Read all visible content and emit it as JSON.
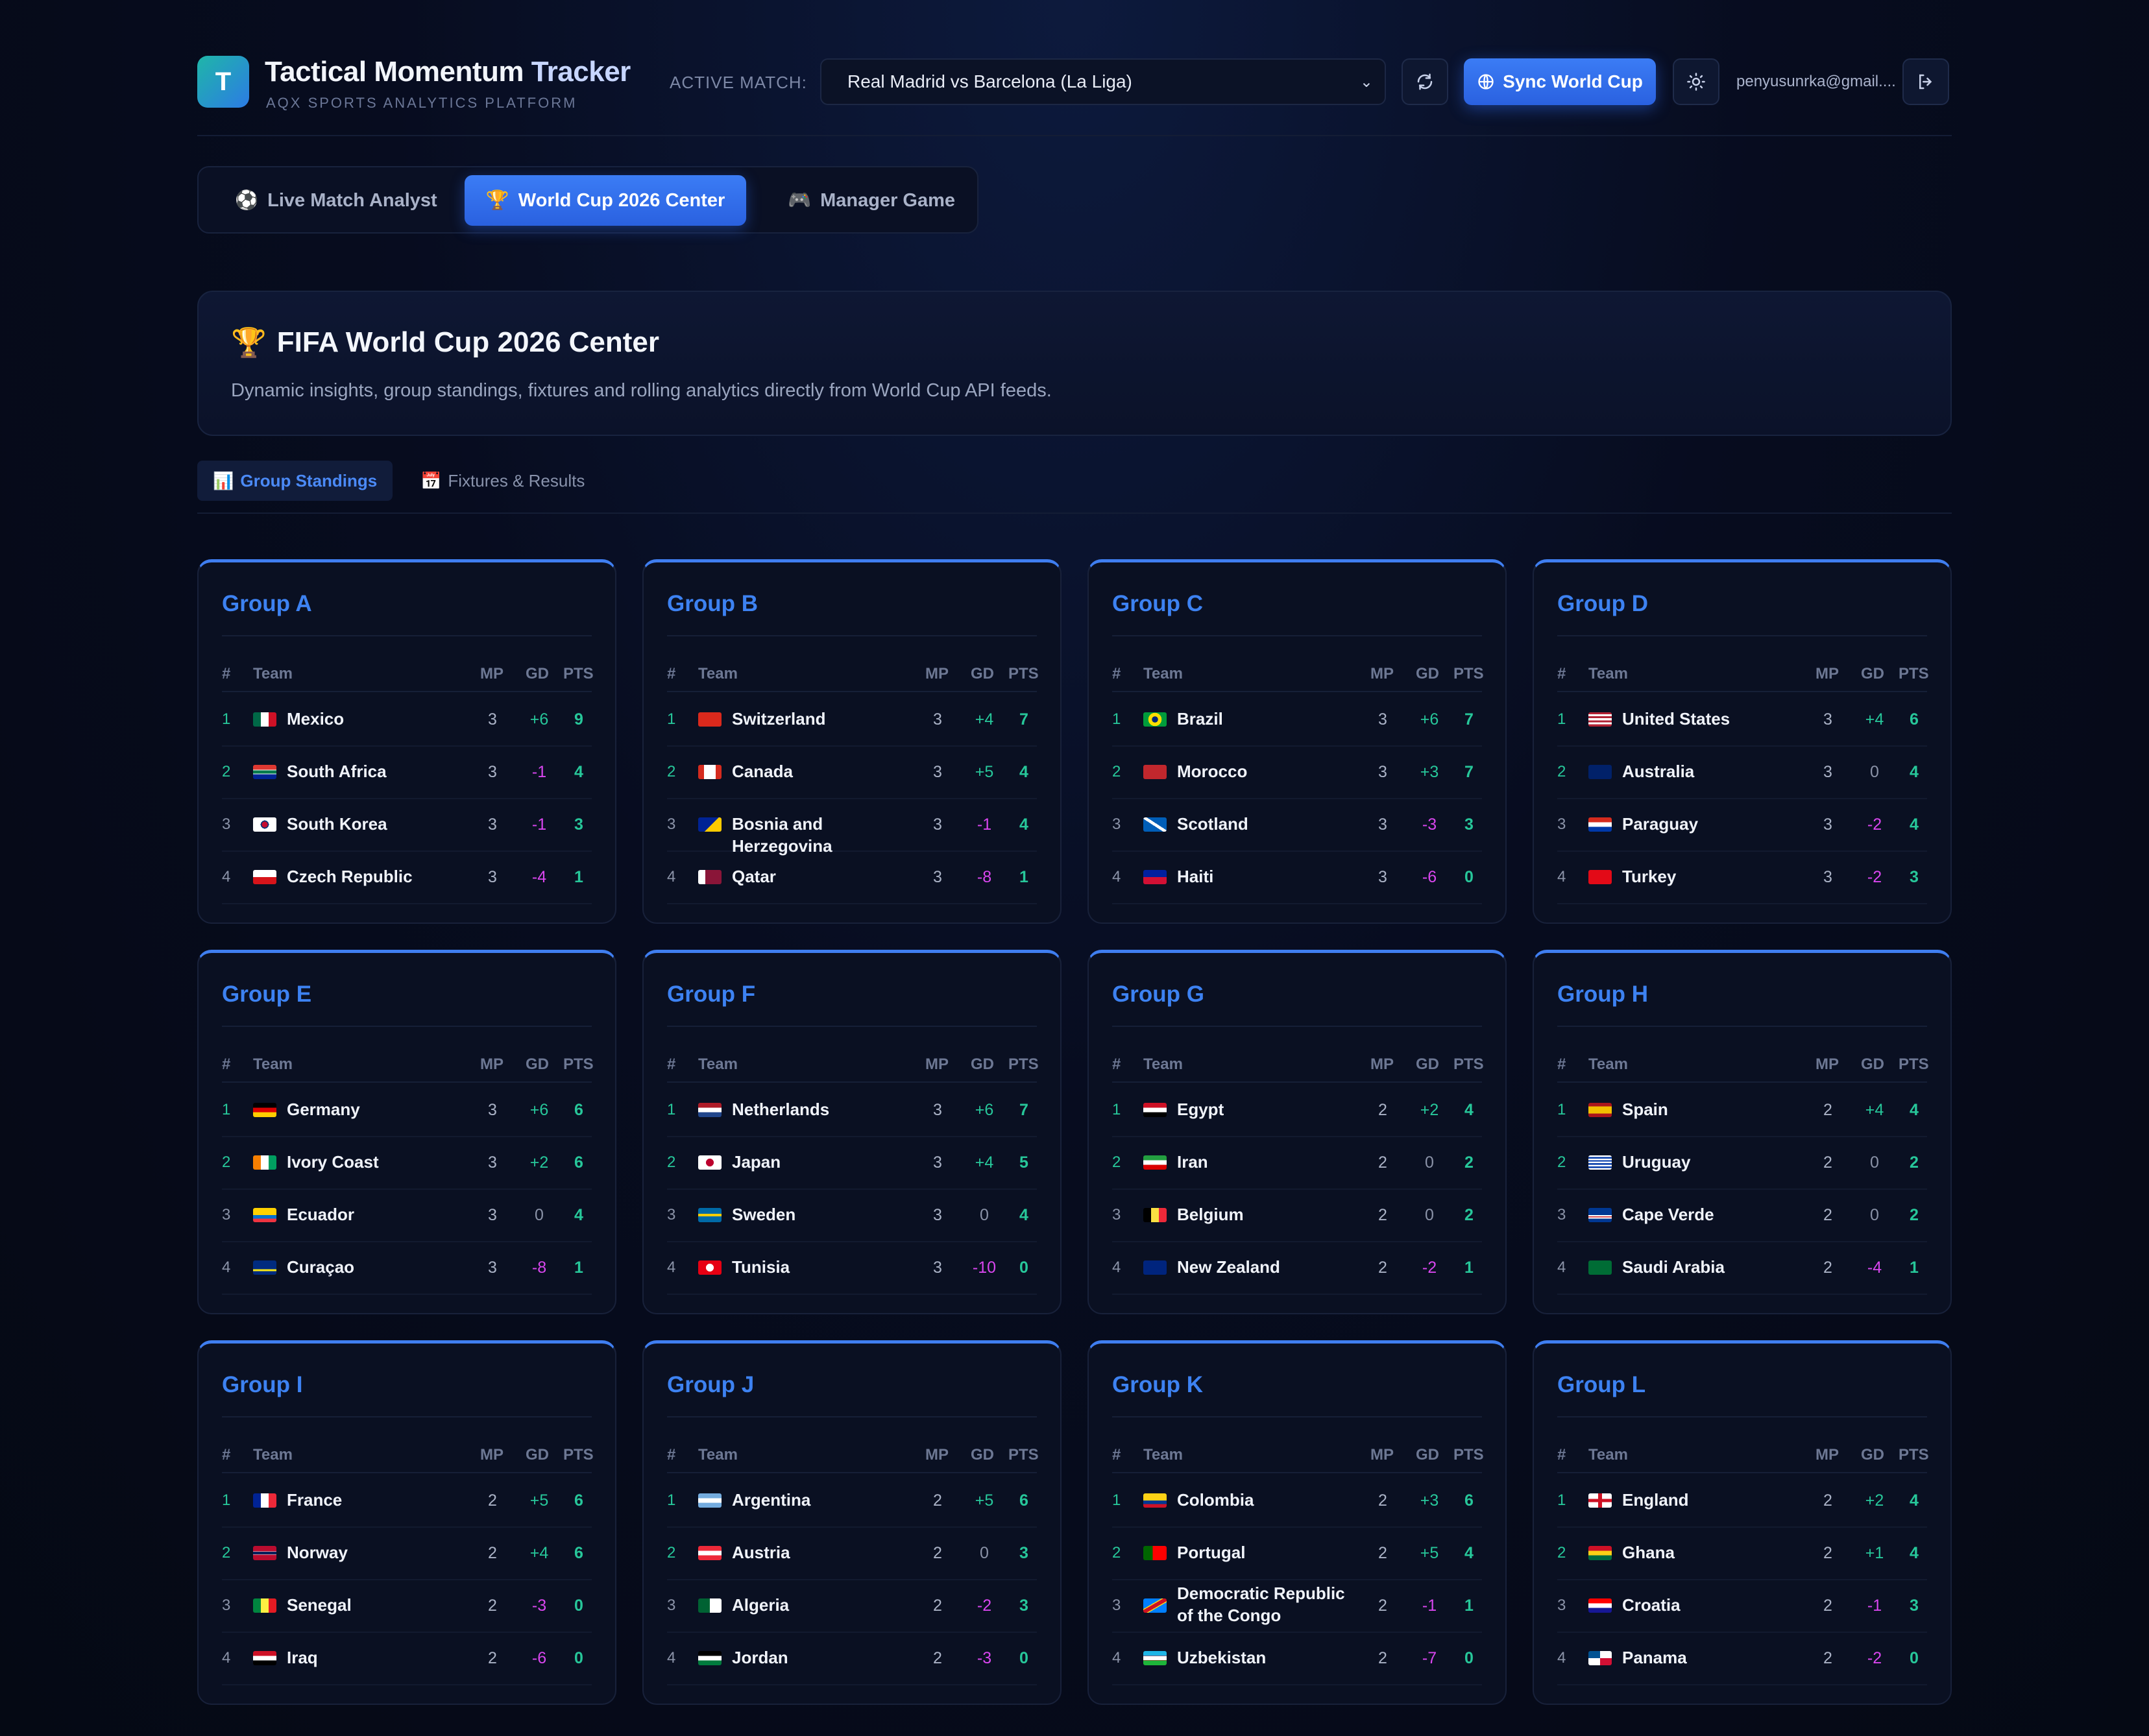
{
  "header": {
    "logo_letter": "T",
    "title_main": "Tactical Momentum ",
    "title_accent": "Tracker",
    "subtitle": "AQX SPORTS ANALYTICS PLATFORM",
    "active_match_label": "ACTIVE MATCH:",
    "active_match_value": "Real Madrid vs Barcelona (La Liga)",
    "sync_label": "Sync World Cup",
    "user_email": "penyusunrka@gmail....",
    "icons": [
      "refresh-icon",
      "globe-icon",
      "sun-icon",
      "logout-icon"
    ]
  },
  "main_tabs": [
    {
      "label": "Live Match Analyst",
      "icon": "⚽",
      "active": false
    },
    {
      "label": "World Cup 2026 Center",
      "icon": "🏆",
      "active": true
    },
    {
      "label": "Manager Game",
      "icon": "🎮",
      "active": false
    }
  ],
  "hero": {
    "icon": "🏆",
    "title": "FIFA World Cup 2026 Center",
    "description": "Dynamic insights, group standings, fixtures and rolling analytics directly from World Cup API feeds."
  },
  "sub_tabs": [
    {
      "label": "Group Standings",
      "icon": "📊",
      "active": true
    },
    {
      "label": "Fixtures & Results",
      "icon": "📅",
      "active": false
    }
  ],
  "table_headers": {
    "rank": "#",
    "team": "Team",
    "mp": "MP",
    "gd": "GD",
    "pts": "PTS"
  },
  "colors": {
    "accent": "#3d82f2",
    "positive": "#27c79a",
    "negative": "#d946ef",
    "neutral": "#8b93a8"
  },
  "groups": [
    {
      "name": "Group A",
      "teams": [
        {
          "rank": "1",
          "team": "Mexico",
          "flag": "mexico",
          "mp": "3",
          "gd": "+6",
          "pts": "9"
        },
        {
          "rank": "2",
          "team": "South Africa",
          "flag": "south-africa",
          "mp": "3",
          "gd": "-1",
          "pts": "4"
        },
        {
          "rank": "3",
          "team": "South Korea",
          "flag": "south-korea",
          "mp": "3",
          "gd": "-1",
          "pts": "3"
        },
        {
          "rank": "4",
          "team": "Czech Republic",
          "flag": "czech-republic",
          "mp": "3",
          "gd": "-4",
          "pts": "1"
        }
      ]
    },
    {
      "name": "Group B",
      "teams": [
        {
          "rank": "1",
          "team": "Switzerland",
          "flag": "switzerland",
          "mp": "3",
          "gd": "+4",
          "pts": "7"
        },
        {
          "rank": "2",
          "team": "Canada",
          "flag": "canada",
          "mp": "3",
          "gd": "+5",
          "pts": "4"
        },
        {
          "rank": "3",
          "team": "Bosnia and Herzegovina",
          "flag": "bosnia",
          "mp": "3",
          "gd": "-1",
          "pts": "4"
        },
        {
          "rank": "4",
          "team": "Qatar",
          "flag": "qatar",
          "mp": "3",
          "gd": "-8",
          "pts": "1"
        }
      ]
    },
    {
      "name": "Group C",
      "teams": [
        {
          "rank": "1",
          "team": "Brazil",
          "flag": "brazil",
          "mp": "3",
          "gd": "+6",
          "pts": "7"
        },
        {
          "rank": "2",
          "team": "Morocco",
          "flag": "morocco",
          "mp": "3",
          "gd": "+3",
          "pts": "7"
        },
        {
          "rank": "3",
          "team": "Scotland",
          "flag": "scotland",
          "mp": "3",
          "gd": "-3",
          "pts": "3"
        },
        {
          "rank": "4",
          "team": "Haiti",
          "flag": "haiti",
          "mp": "3",
          "gd": "-6",
          "pts": "0"
        }
      ]
    },
    {
      "name": "Group D",
      "teams": [
        {
          "rank": "1",
          "team": "United States",
          "flag": "usa",
          "mp": "3",
          "gd": "+4",
          "pts": "6"
        },
        {
          "rank": "2",
          "team": "Australia",
          "flag": "australia",
          "mp": "3",
          "gd": "0",
          "pts": "4"
        },
        {
          "rank": "3",
          "team": "Paraguay",
          "flag": "paraguay",
          "mp": "3",
          "gd": "-2",
          "pts": "4"
        },
        {
          "rank": "4",
          "team": "Turkey",
          "flag": "turkey",
          "mp": "3",
          "gd": "-2",
          "pts": "3"
        }
      ]
    },
    {
      "name": "Group E",
      "teams": [
        {
          "rank": "1",
          "team": "Germany",
          "flag": "germany",
          "mp": "3",
          "gd": "+6",
          "pts": "6"
        },
        {
          "rank": "2",
          "team": "Ivory Coast",
          "flag": "ivory-coast",
          "mp": "3",
          "gd": "+2",
          "pts": "6"
        },
        {
          "rank": "3",
          "team": "Ecuador",
          "flag": "ecuador",
          "mp": "3",
          "gd": "0",
          "pts": "4"
        },
        {
          "rank": "4",
          "team": "Curaçao",
          "flag": "curacao",
          "mp": "3",
          "gd": "-8",
          "pts": "1"
        }
      ]
    },
    {
      "name": "Group F",
      "teams": [
        {
          "rank": "1",
          "team": "Netherlands",
          "flag": "netherlands",
          "mp": "3",
          "gd": "+6",
          "pts": "7"
        },
        {
          "rank": "2",
          "team": "Japan",
          "flag": "japan",
          "mp": "3",
          "gd": "+4",
          "pts": "5"
        },
        {
          "rank": "3",
          "team": "Sweden",
          "flag": "sweden",
          "mp": "3",
          "gd": "0",
          "pts": "4"
        },
        {
          "rank": "4",
          "team": "Tunisia",
          "flag": "tunisia",
          "mp": "3",
          "gd": "-10",
          "pts": "0"
        }
      ]
    },
    {
      "name": "Group G",
      "teams": [
        {
          "rank": "1",
          "team": "Egypt",
          "flag": "egypt",
          "mp": "2",
          "gd": "+2",
          "pts": "4"
        },
        {
          "rank": "2",
          "team": "Iran",
          "flag": "iran",
          "mp": "2",
          "gd": "0",
          "pts": "2"
        },
        {
          "rank": "3",
          "team": "Belgium",
          "flag": "belgium",
          "mp": "2",
          "gd": "0",
          "pts": "2"
        },
        {
          "rank": "4",
          "team": "New Zealand",
          "flag": "new-zealand",
          "mp": "2",
          "gd": "-2",
          "pts": "1"
        }
      ]
    },
    {
      "name": "Group H",
      "teams": [
        {
          "rank": "1",
          "team": "Spain",
          "flag": "spain",
          "mp": "2",
          "gd": "+4",
          "pts": "4"
        },
        {
          "rank": "2",
          "team": "Uruguay",
          "flag": "uruguay",
          "mp": "2",
          "gd": "0",
          "pts": "2"
        },
        {
          "rank": "3",
          "team": "Cape Verde",
          "flag": "cape-verde",
          "mp": "2",
          "gd": "0",
          "pts": "2"
        },
        {
          "rank": "4",
          "team": "Saudi Arabia",
          "flag": "saudi-arabia",
          "mp": "2",
          "gd": "-4",
          "pts": "1"
        }
      ]
    },
    {
      "name": "Group I",
      "teams": [
        {
          "rank": "1",
          "team": "France",
          "flag": "france",
          "mp": "2",
          "gd": "+5",
          "pts": "6"
        },
        {
          "rank": "2",
          "team": "Norway",
          "flag": "norway",
          "mp": "2",
          "gd": "+4",
          "pts": "6"
        },
        {
          "rank": "3",
          "team": "Senegal",
          "flag": "senegal",
          "mp": "2",
          "gd": "-3",
          "pts": "0"
        },
        {
          "rank": "4",
          "team": "Iraq",
          "flag": "iraq",
          "mp": "2",
          "gd": "-6",
          "pts": "0"
        }
      ]
    },
    {
      "name": "Group J",
      "teams": [
        {
          "rank": "1",
          "team": "Argentina",
          "flag": "argentina",
          "mp": "2",
          "gd": "+5",
          "pts": "6"
        },
        {
          "rank": "2",
          "team": "Austria",
          "flag": "austria",
          "mp": "2",
          "gd": "0",
          "pts": "3"
        },
        {
          "rank": "3",
          "team": "Algeria",
          "flag": "algeria",
          "mp": "2",
          "gd": "-2",
          "pts": "3"
        },
        {
          "rank": "4",
          "team": "Jordan",
          "flag": "jordan",
          "mp": "2",
          "gd": "-3",
          "pts": "0"
        }
      ]
    },
    {
      "name": "Group K",
      "teams": [
        {
          "rank": "1",
          "team": "Colombia",
          "flag": "colombia",
          "mp": "2",
          "gd": "+3",
          "pts": "6"
        },
        {
          "rank": "2",
          "team": "Portugal",
          "flag": "portugal",
          "mp": "2",
          "gd": "+5",
          "pts": "4"
        },
        {
          "rank": "3",
          "team": "Democratic Republic of the Congo",
          "flag": "dr-congo",
          "mp": "2",
          "gd": "-1",
          "pts": "1"
        },
        {
          "rank": "4",
          "team": "Uzbekistan",
          "flag": "uzbekistan",
          "mp": "2",
          "gd": "-7",
          "pts": "0"
        }
      ]
    },
    {
      "name": "Group L",
      "teams": [
        {
          "rank": "1",
          "team": "England",
          "flag": "england",
          "mp": "2",
          "gd": "+2",
          "pts": "4"
        },
        {
          "rank": "2",
          "team": "Ghana",
          "flag": "ghana",
          "mp": "2",
          "gd": "+1",
          "pts": "4"
        },
        {
          "rank": "3",
          "team": "Croatia",
          "flag": "croatia",
          "mp": "2",
          "gd": "-1",
          "pts": "3"
        },
        {
          "rank": "4",
          "team": "Panama",
          "flag": "panama",
          "mp": "2",
          "gd": "-2",
          "pts": "0"
        }
      ]
    }
  ]
}
